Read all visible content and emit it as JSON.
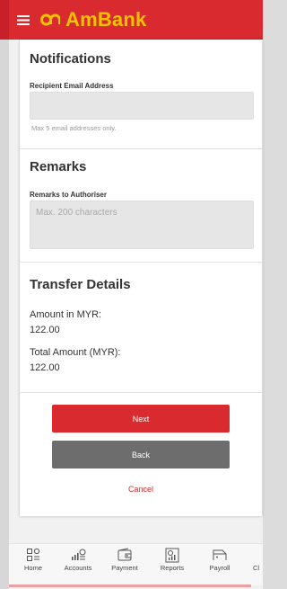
{
  "colors": {
    "brand_red": "#d92a2f",
    "brand_yellow": "#f2c300",
    "grey_button": "#6d6d6d"
  },
  "header": {
    "logo_text": "AmBank",
    "menu_icon": "hamburger-icon"
  },
  "notifications": {
    "title": "Notifications",
    "field_label": "Recipient Email Address",
    "value": "",
    "hint": "Max 5 email addresses only."
  },
  "remarks": {
    "title": "Remarks",
    "field_label": "Remarks to Authoriser",
    "placeholder": "Max. 200 characters"
  },
  "transfer": {
    "title": "Transfer Details",
    "amount_label": "Amount in MYR:",
    "amount_value": "122.00",
    "total_label": "Total Amount (MYR):",
    "total_value": "122.00"
  },
  "actions": {
    "next": "Next",
    "back": "Back",
    "cancel": "Cancel"
  },
  "tabbar": {
    "items": [
      {
        "label": "Home",
        "icon": "home-icon"
      },
      {
        "label": "Accounts",
        "icon": "accounts-icon"
      },
      {
        "label": "Payment",
        "icon": "payment-icon"
      },
      {
        "label": "Reports",
        "icon": "reports-icon"
      },
      {
        "label": "Payroll",
        "icon": "payroll-icon"
      },
      {
        "label": "Cl",
        "icon": ""
      }
    ]
  }
}
